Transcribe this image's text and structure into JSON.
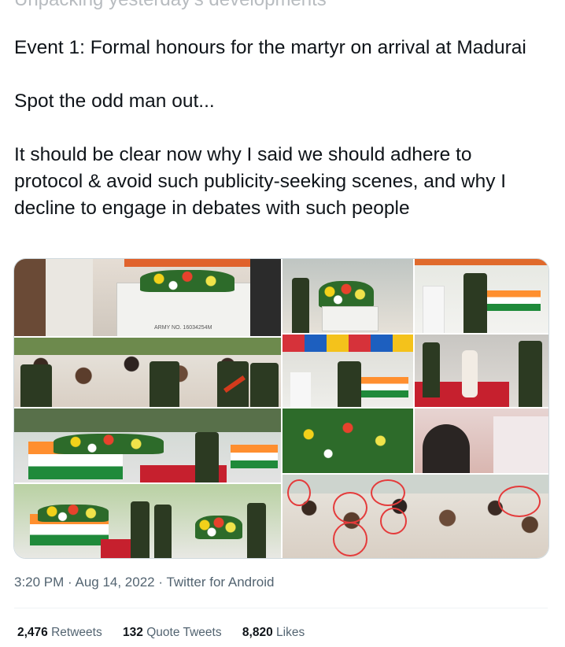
{
  "tweet": {
    "cut_off_line": "Unpacking yesterday's developments",
    "paragraphs": [
      "Event 1: Formal honours for the martyr on arrival at Madurai",
      "Spot the odd man out...",
      "It should be clear now why I said we should adhere to protocol & avoid such publicity-seeking scenes, and why I decline to engage in debates with such people"
    ]
  },
  "media": {
    "photo_label": "ARMY NO. 16034254M"
  },
  "meta": {
    "time": "3:20 PM",
    "sep1": " · ",
    "date": "Aug 14, 2022",
    "sep2": " · ",
    "source": "Twitter for Android"
  },
  "stats": {
    "retweets_count": "2,476",
    "retweets_label": "Retweets",
    "quotes_count": "132",
    "quotes_label": "Quote Tweets",
    "likes_count": "8,820",
    "likes_label": "Likes"
  },
  "colors": {
    "text": "#0f1419",
    "secondary": "#536471",
    "border": "#cfd9de"
  }
}
